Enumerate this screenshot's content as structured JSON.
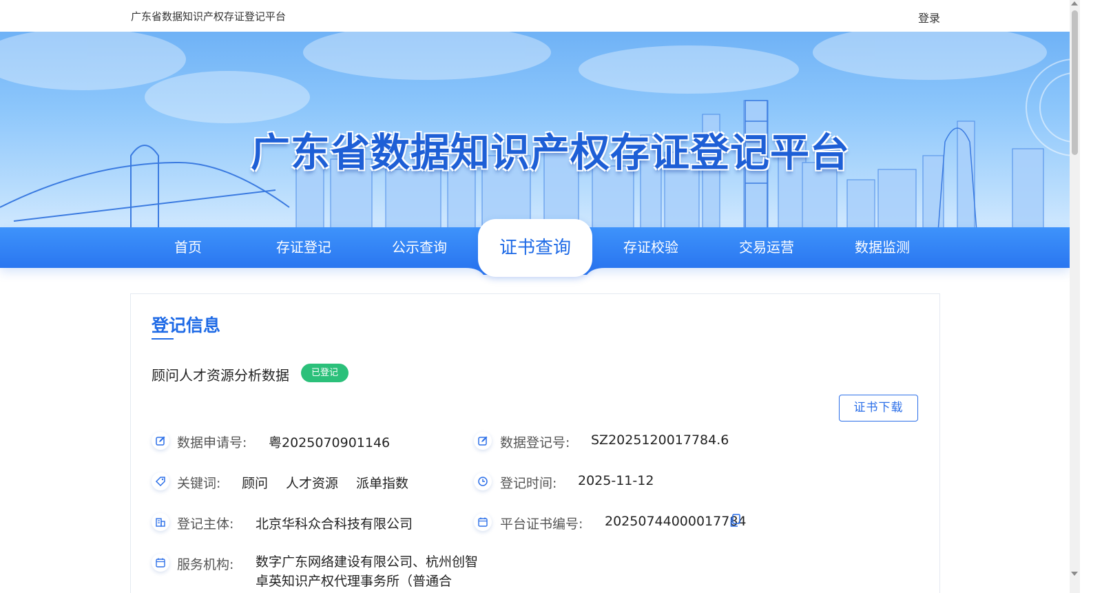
{
  "header": {
    "site_name": "广东省数据知识产权存证登记平台",
    "login_label": "登录"
  },
  "hero": {
    "title": "广东省数据知识产权存证登记平台"
  },
  "nav": {
    "items": [
      {
        "label": "首页"
      },
      {
        "label": "存证登记"
      },
      {
        "label": "公示查询"
      },
      {
        "label": "证书查询",
        "active": true
      },
      {
        "label": "存证校验"
      },
      {
        "label": "交易运营"
      },
      {
        "label": "数据监测"
      }
    ]
  },
  "card": {
    "title": "登记信息",
    "item_name": "顾问人才资源分析数据",
    "status": "已登记",
    "download_label": "证书下载",
    "fields": {
      "application_no": {
        "label": "数据申请号:",
        "value": "粤2025070901146",
        "icon": "edit-icon"
      },
      "registration_no": {
        "label": "数据登记号:",
        "value": "SZ2025120017784.6",
        "icon": "edit-icon"
      },
      "keywords": {
        "label": "关键词:",
        "values": [
          "顾问",
          "人才资源",
          "派单指数"
        ],
        "icon": "tag-icon"
      },
      "registration_time": {
        "label": "登记时间:",
        "value": "2025-11-12",
        "icon": "clock-icon"
      },
      "registrant": {
        "label": "登记主体:",
        "value": "北京华科众合科技有限公司",
        "icon": "building-icon"
      },
      "certificate_no": {
        "label": "平台证书编号:",
        "value": "20250744000017784",
        "icon": "calendar-icon"
      },
      "service_org": {
        "label": "服务机构:",
        "value": "数字广东网络建设有限公司、杭州创智卓英知识产权代理事务所（普通合",
        "icon": "calendar-icon"
      }
    }
  },
  "colors": {
    "primary": "#1e6ae6",
    "nav_bg": "#2a76f0",
    "badge_green": "#2bc07a"
  }
}
